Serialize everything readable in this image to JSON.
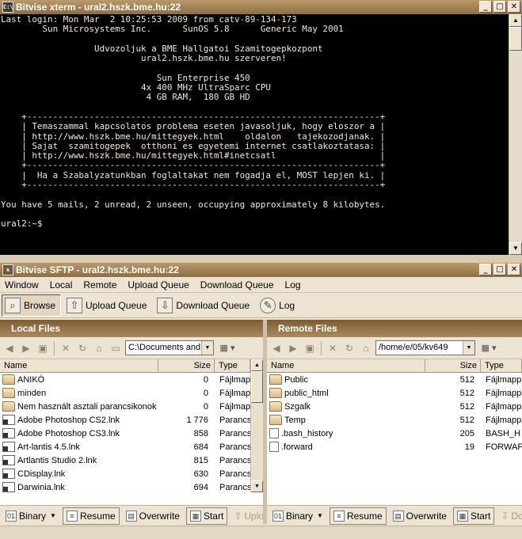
{
  "xterm": {
    "title": "Bitvise xterm - ural2.hszk.bme.hu:22",
    "icon_text": "C:\\",
    "lines": [
      "Last login: Mon Mar  2 10:25:53 2009 from catv-89-134-173",
      "        Sun Microsystems Inc.      SunOS 5.8      Generic May 2001",
      "",
      "                  Udvozoljuk a BME Hallgatoi Szamitogepkozpont",
      "                           ural2.hszk.bme.hu szerveren!",
      "",
      "                              Sun Enterprise 450",
      "                           4x 400 MHz UltraSparc CPU",
      "                            4 GB RAM,  180 GB HD",
      "",
      "    +--------------------------------------------------------------------+",
      "    | Temaszammal kapcsolatos problema eseten javasoljuk, hogy eloszor a |",
      "    | http://www.hszk.bme.hu/mittegyek.html    oldalon   tajekozodjanak. |",
      "    | Sajat  szamitogepek  otthoni es egyetemi internet csatlakoztatasa: |",
      "    | http://www.hszk.bme.hu/mittegyek.html#inetcsatl                    |",
      "    +--------------------------------------------------------------------+",
      "    |  Ha a Szabalyzatunkban foglaltakat nem fogadja el, MOST lepjen ki. |",
      "    +--------------------------------------------------------------------+",
      "",
      "You have 5 mails, 2 unread, 2 unseen, occupying approximately 8 kilobytes.",
      "",
      "ural2:~$"
    ]
  },
  "sftp": {
    "title": "Bitvise SFTP - ural2.hszk.bme.hu:22",
    "menu": [
      "Window",
      "Local",
      "Remote",
      "Upload Queue",
      "Download Queue",
      "Log"
    ],
    "toolbar": {
      "browse": "Browse",
      "upload_queue": "Upload Queue",
      "download_queue": "Download Queue",
      "log": "Log"
    },
    "local": {
      "header": "Local Files",
      "path": "C:\\Documents and",
      "columns": [
        "Name",
        "Size",
        "Type"
      ],
      "rows": [
        {
          "name": "ANIKÓ",
          "size": "0",
          "type": "Fájlmap",
          "icon": "folder"
        },
        {
          "name": "minden",
          "size": "0",
          "type": "Fájlmap",
          "icon": "folder"
        },
        {
          "name": "Nem használt asztali parancsikonok",
          "size": "0",
          "type": "Fájlmap",
          "icon": "folder"
        },
        {
          "name": "Adobe Photoshop CS2.lnk",
          "size": "1 776",
          "type": "Parancs",
          "icon": "lnk"
        },
        {
          "name": "Adobe Photoshop CS3.lnk",
          "size": "858",
          "type": "Parancs",
          "icon": "lnk"
        },
        {
          "name": "Art-lantis 4.5.lnk",
          "size": "684",
          "type": "Parancs",
          "icon": "lnk"
        },
        {
          "name": "Artlantis Studio 2.lnk",
          "size": "815",
          "type": "Parancs",
          "icon": "lnk"
        },
        {
          "name": "CDisplay.lnk",
          "size": "630",
          "type": "Parancs",
          "icon": "lnk"
        },
        {
          "name": "Darwinia.lnk",
          "size": "694",
          "type": "Parancs",
          "icon": "lnk"
        }
      ],
      "bottom": {
        "binary": "Binary",
        "resume": "Resume",
        "overwrite": "Overwrite",
        "start": "Start",
        "upload": "Upload"
      }
    },
    "remote": {
      "header": "Remote Files",
      "path": "/home/e/05/kv649",
      "columns": [
        "Name",
        "Size",
        "Type"
      ],
      "rows": [
        {
          "name": "Public",
          "size": "512",
          "type": "Fájlmappa",
          "icon": "folder"
        },
        {
          "name": "public_html",
          "size": "512",
          "type": "Fájlmappa",
          "icon": "folder"
        },
        {
          "name": "Szgalk",
          "size": "512",
          "type": "Fájlmappa",
          "icon": "folder"
        },
        {
          "name": "Temp",
          "size": "512",
          "type": "Fájlmappa",
          "icon": "folder"
        },
        {
          "name": ".bash_history",
          "size": "205",
          "type": "BASH_H",
          "icon": "file"
        },
        {
          "name": ".forward",
          "size": "19",
          "type": "FORWAF",
          "icon": "file"
        }
      ],
      "bottom": {
        "binary": "Binary",
        "resume": "Resume",
        "overwrite": "Overwrite",
        "start": "Start",
        "download": "Dow"
      }
    }
  }
}
